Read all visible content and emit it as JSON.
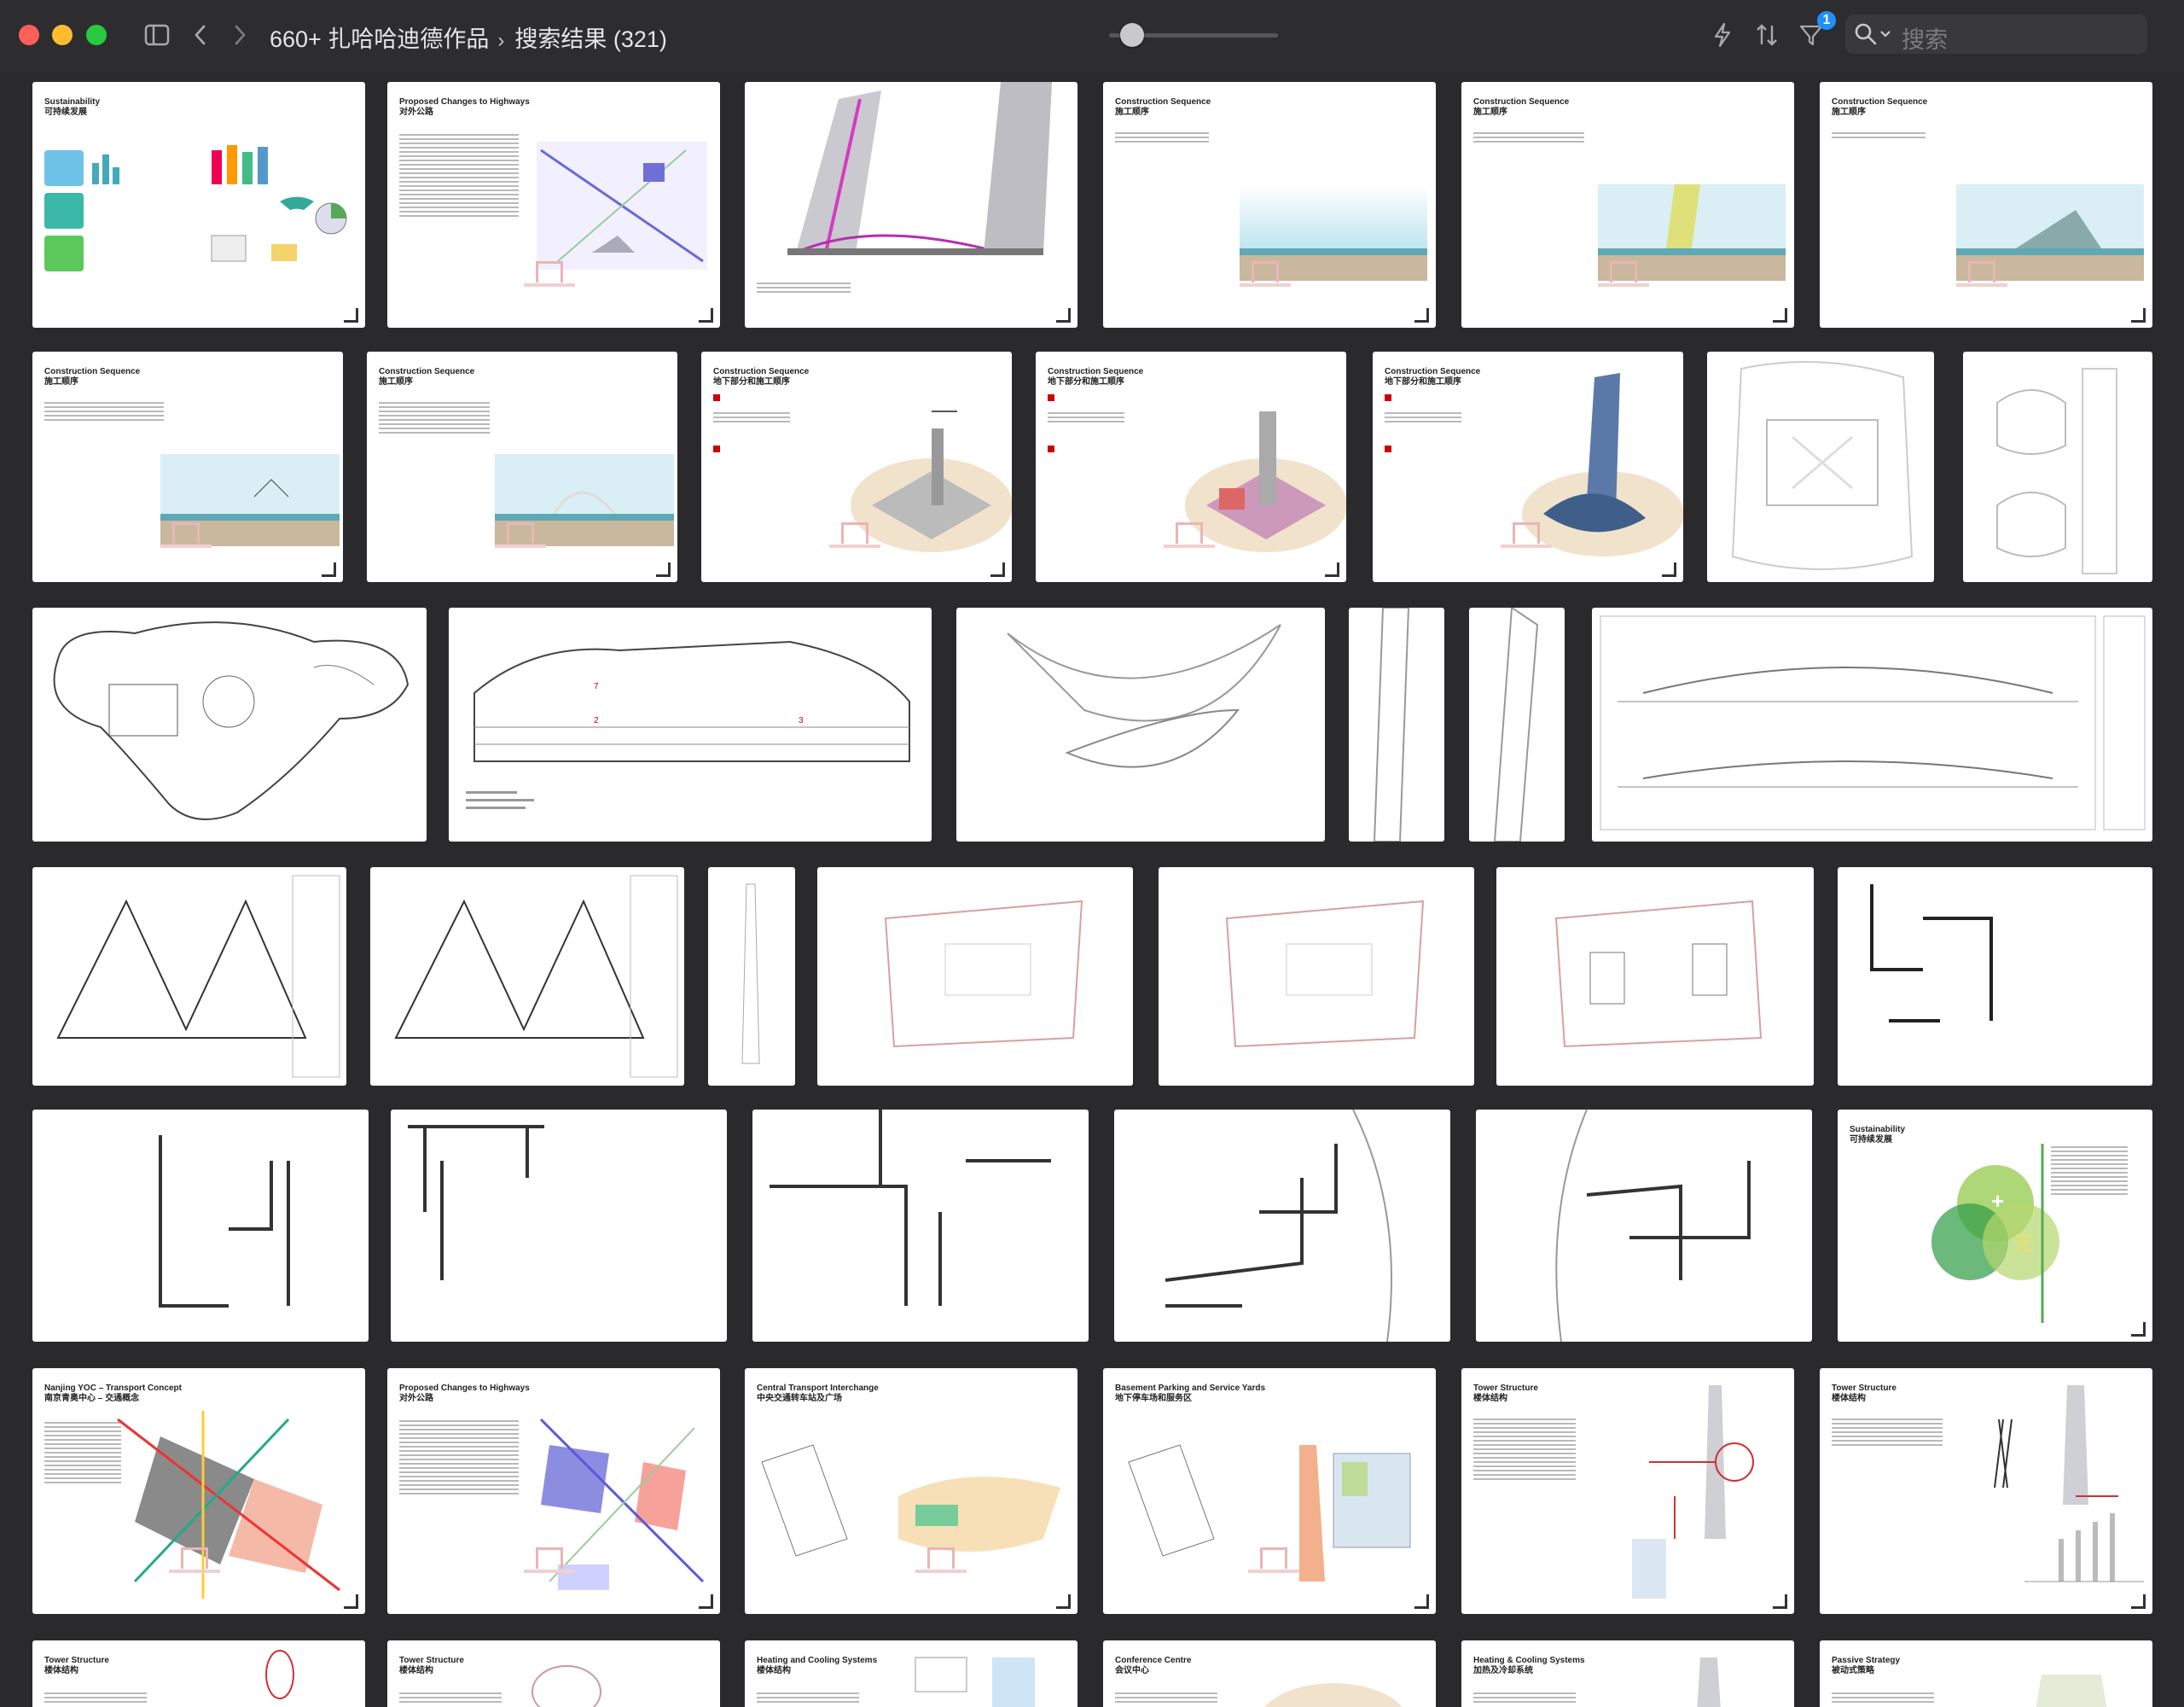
{
  "window": {
    "title_folder": "660+ 扎哈哈迪德作品",
    "title_result": "搜索结果 (321)",
    "filter_badge": "1",
    "search_placeholder": "搜索"
  },
  "icons": [
    "close-dot",
    "minimize-dot",
    "zoom-dot",
    "sidebar-icon",
    "back-icon",
    "forward-icon",
    "flash-icon",
    "sort-icon",
    "filter-icon",
    "search-icon",
    "chevron-down-icon"
  ],
  "colors": {
    "accent": "#1f8fff",
    "background": "#2a2a2d",
    "red_light": "#fe5f57",
    "yellow_light": "#febc2e",
    "green_light": "#28c840"
  },
  "thumbnails": {
    "r1": [
      {
        "t1": "Sustainability",
        "t2": "可持续发展"
      },
      {
        "t1": "Proposed Changes to Highways",
        "t2": "对外公路"
      },
      {
        "t1": "",
        "t2": ""
      },
      {
        "t1": "Construction Sequence",
        "t2": "施工顺序"
      },
      {
        "t1": "Construction Sequence",
        "t2": "施工顺序"
      },
      {
        "t1": "Construction Sequence",
        "t2": "施工顺序"
      }
    ],
    "r2": [
      {
        "t1": "Construction Sequence",
        "t2": "施工顺序"
      },
      {
        "t1": "Construction Sequence",
        "t2": "施工顺序"
      },
      {
        "t1": "Construction  Sequence",
        "t2": "地下部分和施工顺序"
      },
      {
        "t1": "Construction  Sequence",
        "t2": "地下部分和施工顺序"
      },
      {
        "t1": "Construction  Sequence",
        "t2": "地下部分和施工顺序"
      }
    ],
    "r5": {
      "t1": "Sustainability",
      "t2": "可持续发展"
    },
    "r6": [
      {
        "t1": "Nanjing YOC – Transport Concept",
        "t2": "南京青奥中心 – 交通概念"
      },
      {
        "t1": "Proposed Changes to Highways",
        "t2": "对外公路"
      },
      {
        "t1": "Central Transport Interchange",
        "t2": "中央交通转车站及广场"
      },
      {
        "t1": "Basement Parking and Service Yards",
        "t2": "地下停车场和服务区"
      },
      {
        "t1": "Tower Structure",
        "t2": "楼体结构"
      },
      {
        "t1": "Tower Structure",
        "t2": "楼体结构"
      }
    ],
    "r7": [
      {
        "t1": "Tower Structure",
        "t2": "楼体结构"
      },
      {
        "t1": "Tower Structure",
        "t2": "楼体结构"
      },
      {
        "t1": "Heating and Cooling Systems",
        "t2": "楼体结构"
      },
      {
        "t1": "Conference Centre",
        "t2": "会议中心"
      },
      {
        "t1": "Heating & Cooling Systems",
        "t2": "加热及冷却系统"
      },
      {
        "t1": "Passive Strategy",
        "t2": "被动式策略"
      }
    ]
  }
}
